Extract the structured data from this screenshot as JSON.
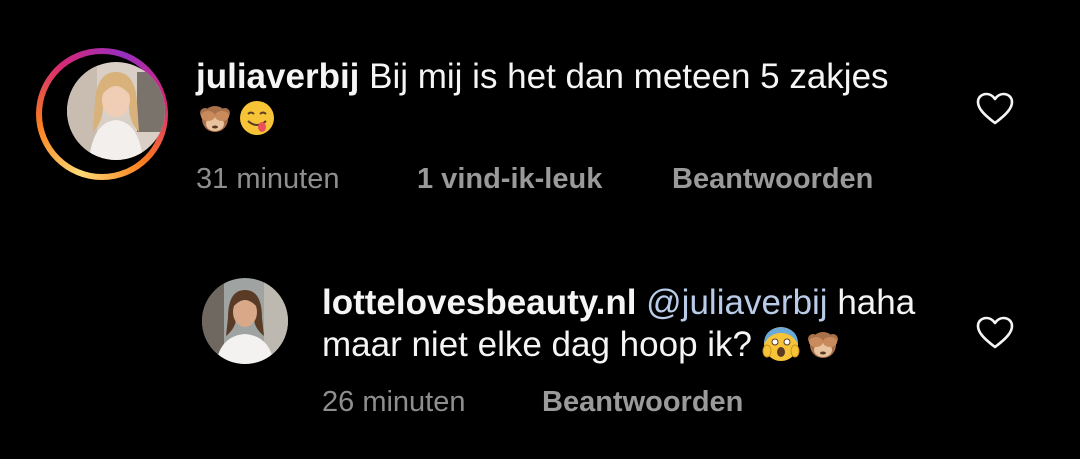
{
  "comments": [
    {
      "username": "juliaverbij",
      "text": " Bij mij is het dan meteen 5 zakjes",
      "emojis": [
        "see-no-evil-monkey",
        "face-savoring-food"
      ],
      "time": "31 minuten",
      "likes": "1 vind-ik-leuk",
      "reply_label": "Beantwoorden",
      "has_story_ring": true
    },
    {
      "username": "lottelovesbeauty.nl",
      "mention": "@juliaverbij",
      "text_line1": " haha",
      "text_line2": "maar niet elke dag hoop ik? ",
      "emojis": [
        "face-screaming-in-fear",
        "see-no-evil-monkey"
      ],
      "time": "26 minuten",
      "reply_label": "Beantwoorden",
      "has_story_ring": false
    }
  ],
  "colors": {
    "background": "#000000",
    "text": "#f5f5f5",
    "meta": "#8e8e8e",
    "mention": "#b8cce8"
  }
}
